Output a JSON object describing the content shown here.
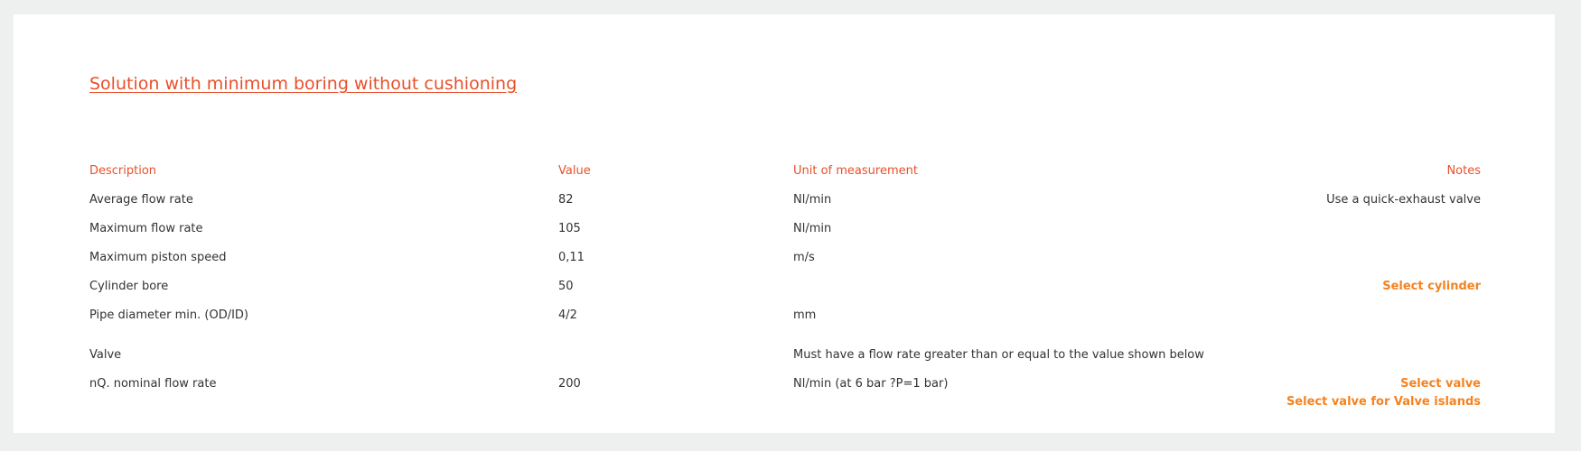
{
  "title": "Solution with minimum boring without cushioning",
  "colors": {
    "accent": "#e8502a",
    "link": "#f5821f",
    "text": "#333333",
    "background": "#eef0ef"
  },
  "table": {
    "headers": {
      "description": "Description",
      "value": "Value",
      "unit": "Unit of measurement",
      "notes": "Notes"
    },
    "rows": [
      {
        "description": "Average flow rate",
        "value": "82",
        "unit": "Nl/min",
        "notes": "Use a quick-exhaust valve"
      },
      {
        "description": "Maximum flow rate",
        "value": "105",
        "unit": "Nl/min",
        "notes": ""
      },
      {
        "description": "Maximum piston speed",
        "value": "0,11",
        "unit": "m/s",
        "notes": ""
      },
      {
        "description": "Cylinder bore",
        "value": "50",
        "unit": "",
        "notes": ""
      },
      {
        "description": "Pipe diameter min. (OD/ID)",
        "value": "4/2",
        "unit": "mm",
        "notes": ""
      },
      {
        "description": "Valve",
        "value": "",
        "unit": "Must have a flow rate greater than or equal to the value shown below",
        "notes": ""
      },
      {
        "description": "nQ. nominal flow rate",
        "value": "200",
        "unit": "Nl/min (at 6 bar ?P=1 bar)",
        "notes": ""
      }
    ],
    "links": {
      "select_cylinder": "Select cylinder",
      "select_valve": "Select valve",
      "select_valve_islands": "Select valve for Valve islands"
    }
  }
}
